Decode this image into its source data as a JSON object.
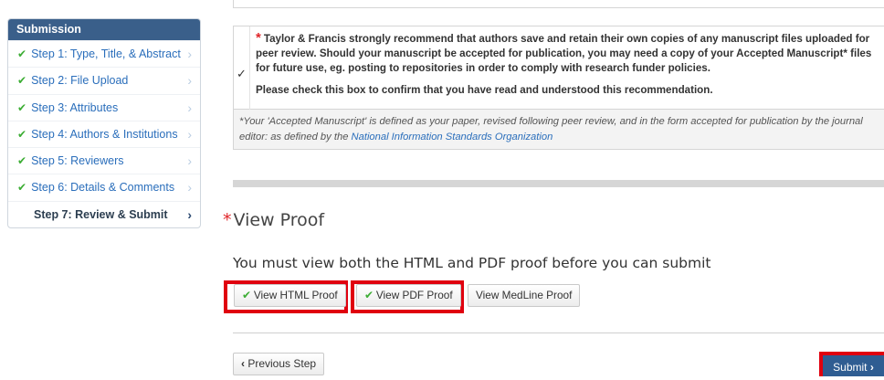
{
  "sidebar": {
    "title": "Submission",
    "steps": [
      {
        "label": "Step 1: Type, Title, & Abstract",
        "done": true
      },
      {
        "label": "Step 2: File Upload",
        "done": true
      },
      {
        "label": "Step 3: Attributes",
        "done": true
      },
      {
        "label": "Step 4: Authors & Institutions",
        "done": true
      },
      {
        "label": "Step 5: Reviewers",
        "done": true
      },
      {
        "label": "Step 6: Details & Comments",
        "done": true
      },
      {
        "label": "Step 7: Review & Submit",
        "done": false
      }
    ]
  },
  "confirmation": {
    "required_mark": "*",
    "recommendation": "Taylor & Francis strongly recommend that authors save and retain their own copies of any manuscript files uploaded for peer review. Should your manuscript be accepted for publication, you may need a copy of your Accepted Manuscript* files for future use, eg. posting to repositories in order to comply with research funder policies.",
    "instruction": "Please check this box to confirm that you have read and understood this recommendation.",
    "checked_mark": "✓",
    "note_text": "*Your 'Accepted Manuscript' is defined as your paper, revised following peer review, and in the form accepted for publication by the journal editor: as defined by the ",
    "note_link": "National Information Standards Organization"
  },
  "proof": {
    "required_mark": "*",
    "title": "View Proof",
    "instruction": "You must view both the HTML and PDF proof before you can submit",
    "buttons": {
      "html": "View HTML Proof",
      "pdf": "View PDF Proof",
      "medline": "View MedLine Proof"
    }
  },
  "footer": {
    "previous": "Previous Step",
    "submit": "Submit"
  },
  "colors": {
    "accent": "#3a5f8a",
    "check_green": "#3cad34",
    "link": "#2a6ebb",
    "highlight_red": "#e0000f"
  }
}
